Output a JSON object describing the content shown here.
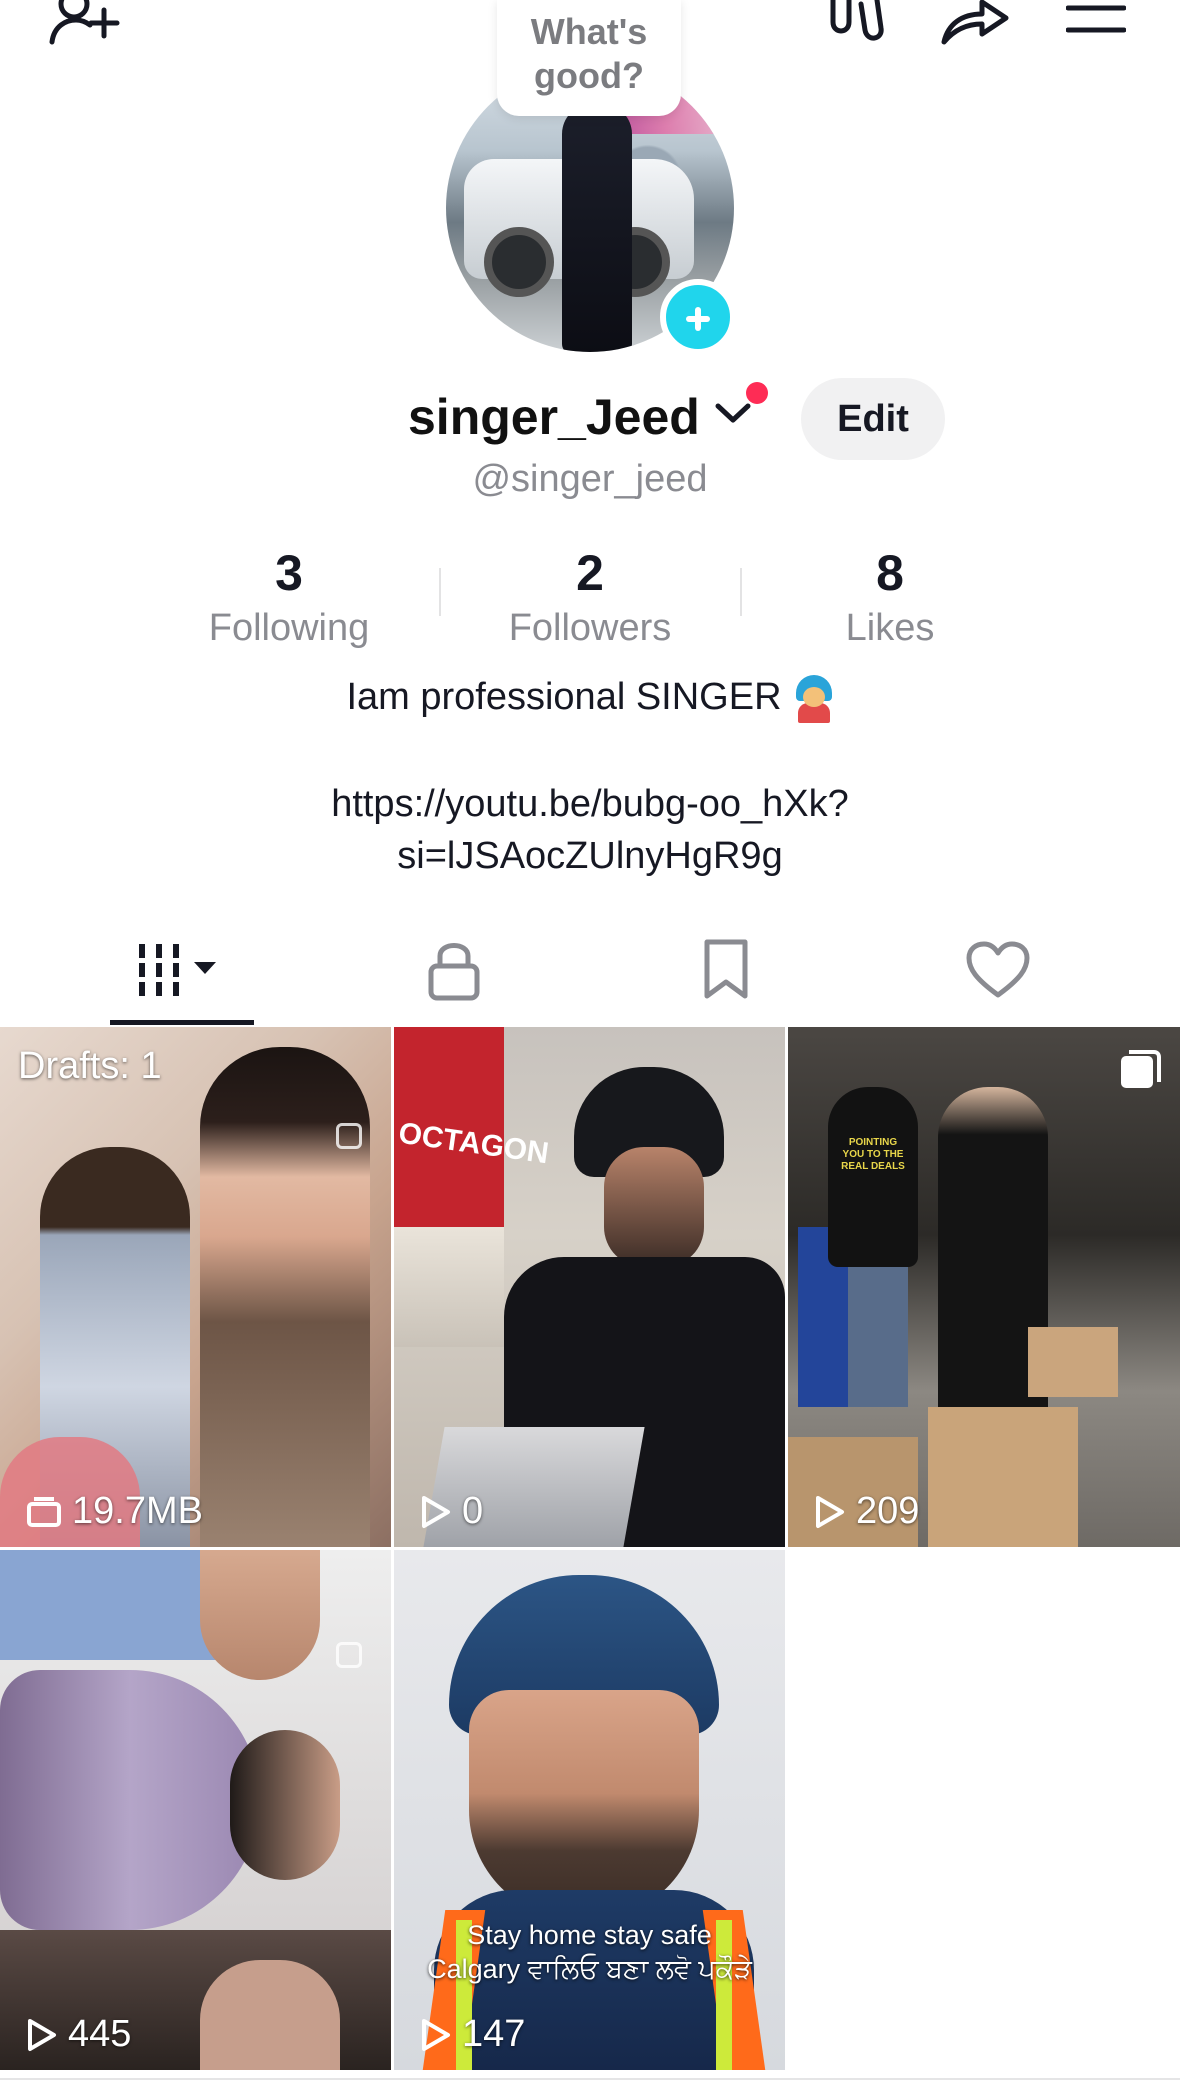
{
  "profile": {
    "bubble_text": "What's good?",
    "display_name": "singer_Jeed",
    "handle": "@singer_jeed",
    "edit_label": "Edit"
  },
  "stats": [
    {
      "value": "3",
      "label": "Following"
    },
    {
      "value": "2",
      "label": "Followers"
    },
    {
      "value": "8",
      "label": "Likes"
    }
  ],
  "bio": {
    "text": "Iam professional SINGER",
    "emoji": "singer-emoji-icon",
    "link_line1": "https://youtu.be/bubg-oo_hXk?",
    "link_line2": "si=lJSAocZUlnyHgR9g"
  },
  "tabs": [
    {
      "icon": "videos-grid-icon",
      "active": true
    },
    {
      "icon": "lock-icon",
      "active": false
    },
    {
      "icon": "bookmark-icon",
      "active": false
    },
    {
      "icon": "heart-icon",
      "active": false
    }
  ],
  "grid": {
    "drafts_label": "Drafts: 1",
    "items": [
      {
        "label": "19.7MB"
      },
      {
        "label": "0",
        "brand": "OCTAGON"
      },
      {
        "label": "209",
        "shirt_text": "POINTING YOU TO THE REAL DEALS"
      },
      {
        "label": "445"
      },
      {
        "label": "147",
        "caption_line1": "Stay home stay safe",
        "caption_line2": "Calgary ਵਾਲਿਓ ਬਣਾ ਲਵੋ ਪਕੌੜੇ"
      }
    ]
  },
  "colors": {
    "accent_cyan": "#20d5ec",
    "notification_red": "#fe2c55",
    "text_primary": "#161823",
    "text_secondary": "#8a8b91"
  }
}
